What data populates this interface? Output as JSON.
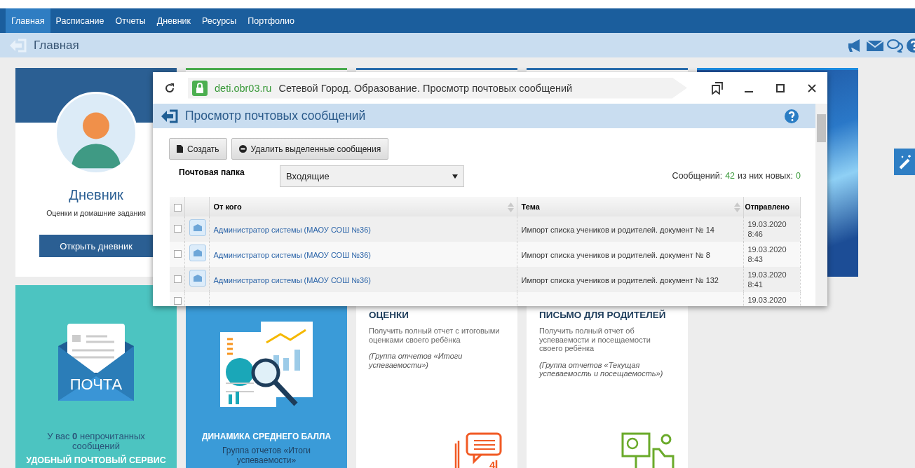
{
  "nav": {
    "tabs": [
      {
        "label": "Главная",
        "selected": true
      },
      {
        "label": "Расписание",
        "selected": false
      },
      {
        "label": "Отчеты",
        "selected": false
      },
      {
        "label": "Дневник",
        "selected": false
      },
      {
        "label": "Ресурсы",
        "selected": false
      },
      {
        "label": "Портфолио",
        "selected": false
      }
    ]
  },
  "breadcrumb": {
    "title": "Главная"
  },
  "diary_card": {
    "title": "Дневник",
    "subtitle": "Оценки и домашние задания",
    "button": "Открыть дневник"
  },
  "mail_card": {
    "logo_text": "ПОЧТА",
    "unread_text": "У вас **0** непрочитанных сообщений",
    "footer": "УДОБНЫЙ ПОЧТОВЫЙ СЕРВИС"
  },
  "chart_card": {
    "title": "ДИНАМИКА СРЕДНЕГО БАЛЛА",
    "subtitle": "Группа отчетов «Итоги успеваемости»"
  },
  "report_cards": [
    {
      "kind": "grades",
      "title": "ОЦЕНКИ",
      "description": "Получить полный отчет с итоговыми оценками своего ребёнка",
      "note": "(Группа отчетов «Итоги успеваемости»)",
      "icon_digit": "4"
    },
    {
      "kind": "letter",
      "title": "ПИСЬМО ДЛЯ РОДИТЕЛЕЙ",
      "description": "Получить полный отчет об успеваемости и посещаемости своего ребёнка",
      "note": "(Группа отчетов «Текущая успеваемость и посещаемость»)"
    }
  ],
  "popup": {
    "url": "deti.obr03.ru",
    "window_title": "Сетевой Город. Образование. Просмотр почтовых сообщений",
    "page_title": "Просмотр почтовых сообщений",
    "buttons": [
      {
        "kind": "create",
        "label": "Создать"
      },
      {
        "kind": "delete",
        "label": "Удалить выделенные сообщения"
      }
    ],
    "folder_label": "Почтовая папка",
    "folder": "Входящие",
    "count_label": "Сообщений:",
    "count": "42",
    "new_label": "из них новых:",
    "new_count": "0",
    "table": {
      "columns": [
        "От кого",
        "Тема",
        "Отправлено"
      ],
      "rows": [
        {
          "checked": false,
          "from": "Администратор системы (МАОУ СОШ №36)",
          "subject": "Импорт списка учеников и родителей. документ № 14",
          "date": "19.03.2020",
          "time": "8:46"
        },
        {
          "checked": false,
          "from": "Администратор системы (МАОУ СОШ №36)",
          "subject": "Импорт списка учеников и родителей. документ № 8",
          "date": "19.03.2020",
          "time": "8:43"
        },
        {
          "checked": false,
          "from": "Администратор системы (МАОУ СОШ №36)",
          "subject": "Импорт списка учеников и родителей. документ № 132",
          "date": "19.03.2020",
          "time": "8:41"
        },
        {
          "checked": false,
          "date": "19.03.2020"
        }
      ],
      "all_checked": false
    }
  }
}
